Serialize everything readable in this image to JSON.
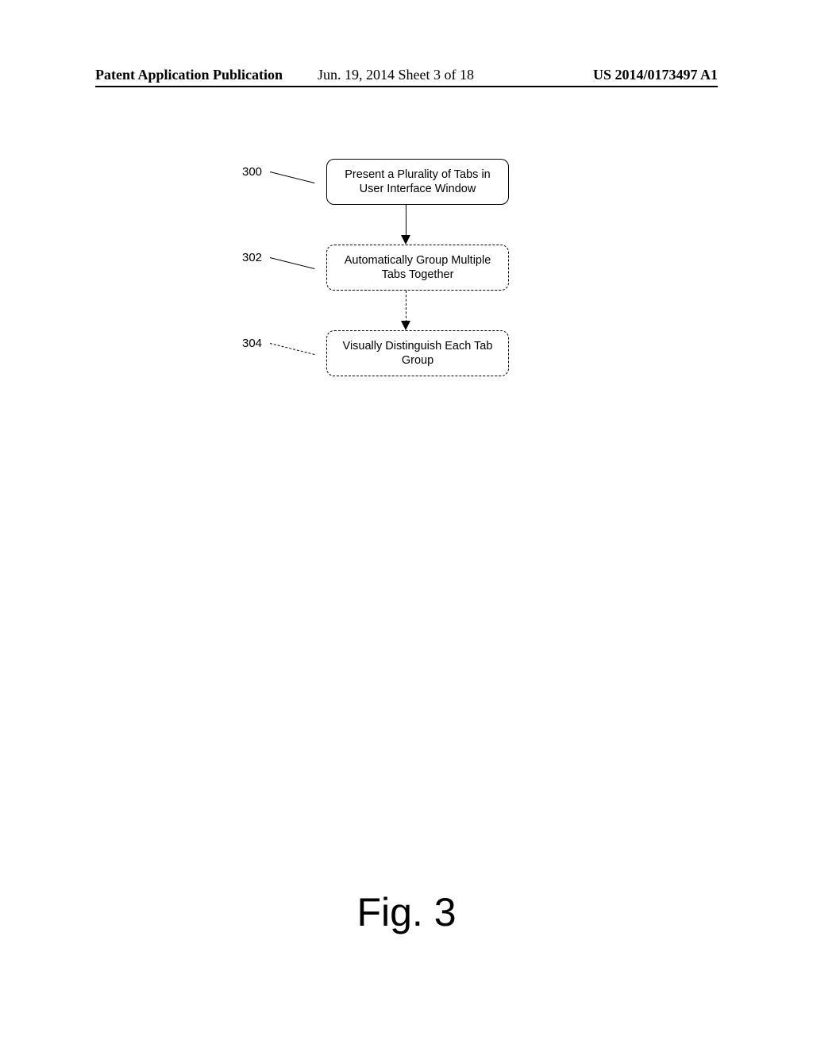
{
  "header": {
    "left": "Patent Application Publication",
    "center": "Jun. 19, 2014  Sheet 3 of 18",
    "right": "US 2014/0173497 A1"
  },
  "steps": [
    {
      "ref": "300",
      "text": "Present a Plurality of Tabs in User Interface Window",
      "border": "solid",
      "leader": "solid",
      "arrow_after": "solid"
    },
    {
      "ref": "302",
      "text": "Automatically Group Multiple Tabs Together",
      "border": "dashed",
      "leader": "solid",
      "arrow_after": "dashed"
    },
    {
      "ref": "304",
      "text": "Visually Distinguish Each Tab Group",
      "border": "dashed",
      "leader": "dashed",
      "arrow_after": null
    }
  ],
  "figure_label": "Fig. 3"
}
